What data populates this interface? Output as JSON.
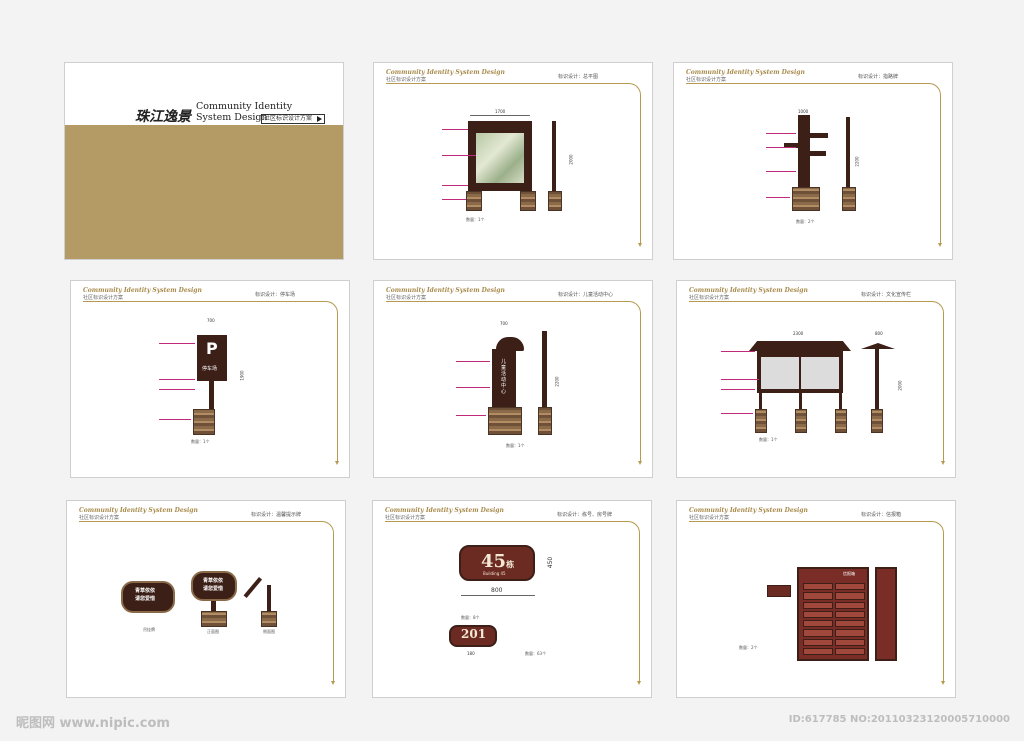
{
  "cover": {
    "logo_text": "珠江逸景",
    "title_en_line1": "Community Identity",
    "title_en_line2": "System Design",
    "subtitle_cn": "社区标识设计方案",
    "accent": "#b49a64"
  },
  "header": {
    "en": "Community Identity System Design",
    "cn": "社区标识设计方案"
  },
  "pages": [
    {
      "title": "标识设计：总平图",
      "qty": "数量：1个",
      "dim_w": "1700",
      "dim_h": "2000"
    },
    {
      "title": "标识设计：指路牌",
      "qty": "数量：2个",
      "dim_w": "1000",
      "dim_h": "2200"
    },
    {
      "title": "标识设计：停车场",
      "qty": "数量：1个",
      "dim_w": "700",
      "dim_h": "1900",
      "sign_letter": "P",
      "sign_text": "停车场"
    },
    {
      "title": "标识设计：儿童活动中心",
      "qty": "数量：1个",
      "dim_w": "700",
      "dim_h": "2200",
      "sign_text": "儿童活动中心"
    },
    {
      "title": "标识设计：文化宣传栏",
      "qty": "数量：1个",
      "dim_w": "2300",
      "dim_w2": "800",
      "dim_h": "2000"
    },
    {
      "title": "标识设计：温馨提示牌",
      "sign_text1": "青草依依",
      "sign_text2": "请您爱惜",
      "label1": "吊挂牌",
      "label2": "正面图",
      "label3": "侧面图"
    },
    {
      "title": "标识设计：栋号、房号牌",
      "number1": "45",
      "number1_unit": "栋",
      "number1_en": "Building 45",
      "dim_w": "800",
      "dim_h": "450",
      "number2": "201",
      "dim_w2": "180",
      "qty1": "数量：8个",
      "qty2": "数量：63个"
    },
    {
      "title": "标识设计：信报箱",
      "mailbox_title": "信报箱",
      "qty": "数量：2个"
    }
  ],
  "footer": {
    "left_brand": "昵图网 www.nipic.com",
    "right_id": "ID:617785 NO:20110323120005710000"
  }
}
